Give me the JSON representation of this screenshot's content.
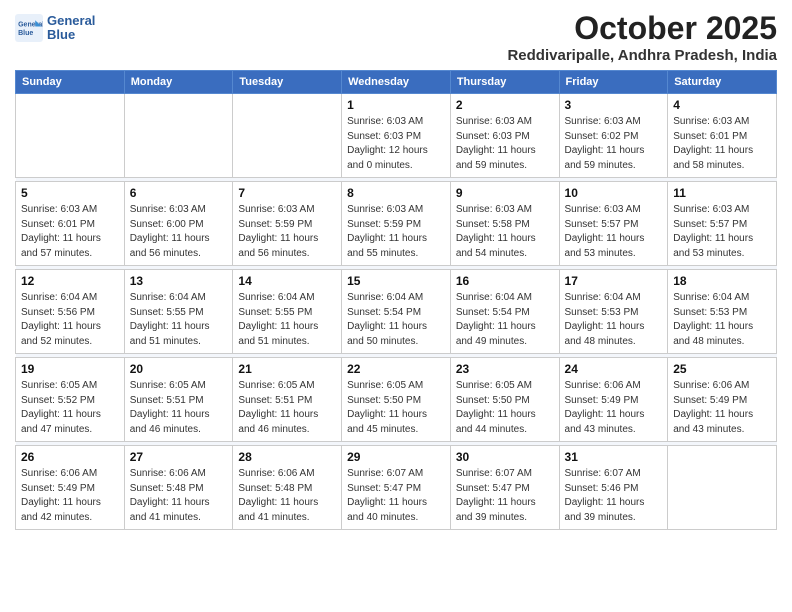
{
  "logo": {
    "line1": "General",
    "line2": "Blue"
  },
  "title": "October 2025",
  "subtitle": "Reddivaripalle, Andhra Pradesh, India",
  "weekdays": [
    "Sunday",
    "Monday",
    "Tuesday",
    "Wednesday",
    "Thursday",
    "Friday",
    "Saturday"
  ],
  "weeks": [
    [
      {
        "day": "",
        "info": ""
      },
      {
        "day": "",
        "info": ""
      },
      {
        "day": "",
        "info": ""
      },
      {
        "day": "1",
        "info": "Sunrise: 6:03 AM\nSunset: 6:03 PM\nDaylight: 12 hours\nand 0 minutes."
      },
      {
        "day": "2",
        "info": "Sunrise: 6:03 AM\nSunset: 6:03 PM\nDaylight: 11 hours\nand 59 minutes."
      },
      {
        "day": "3",
        "info": "Sunrise: 6:03 AM\nSunset: 6:02 PM\nDaylight: 11 hours\nand 59 minutes."
      },
      {
        "day": "4",
        "info": "Sunrise: 6:03 AM\nSunset: 6:01 PM\nDaylight: 11 hours\nand 58 minutes."
      }
    ],
    [
      {
        "day": "5",
        "info": "Sunrise: 6:03 AM\nSunset: 6:01 PM\nDaylight: 11 hours\nand 57 minutes."
      },
      {
        "day": "6",
        "info": "Sunrise: 6:03 AM\nSunset: 6:00 PM\nDaylight: 11 hours\nand 56 minutes."
      },
      {
        "day": "7",
        "info": "Sunrise: 6:03 AM\nSunset: 5:59 PM\nDaylight: 11 hours\nand 56 minutes."
      },
      {
        "day": "8",
        "info": "Sunrise: 6:03 AM\nSunset: 5:59 PM\nDaylight: 11 hours\nand 55 minutes."
      },
      {
        "day": "9",
        "info": "Sunrise: 6:03 AM\nSunset: 5:58 PM\nDaylight: 11 hours\nand 54 minutes."
      },
      {
        "day": "10",
        "info": "Sunrise: 6:03 AM\nSunset: 5:57 PM\nDaylight: 11 hours\nand 53 minutes."
      },
      {
        "day": "11",
        "info": "Sunrise: 6:03 AM\nSunset: 5:57 PM\nDaylight: 11 hours\nand 53 minutes."
      }
    ],
    [
      {
        "day": "12",
        "info": "Sunrise: 6:04 AM\nSunset: 5:56 PM\nDaylight: 11 hours\nand 52 minutes."
      },
      {
        "day": "13",
        "info": "Sunrise: 6:04 AM\nSunset: 5:55 PM\nDaylight: 11 hours\nand 51 minutes."
      },
      {
        "day": "14",
        "info": "Sunrise: 6:04 AM\nSunset: 5:55 PM\nDaylight: 11 hours\nand 51 minutes."
      },
      {
        "day": "15",
        "info": "Sunrise: 6:04 AM\nSunset: 5:54 PM\nDaylight: 11 hours\nand 50 minutes."
      },
      {
        "day": "16",
        "info": "Sunrise: 6:04 AM\nSunset: 5:54 PM\nDaylight: 11 hours\nand 49 minutes."
      },
      {
        "day": "17",
        "info": "Sunrise: 6:04 AM\nSunset: 5:53 PM\nDaylight: 11 hours\nand 48 minutes."
      },
      {
        "day": "18",
        "info": "Sunrise: 6:04 AM\nSunset: 5:53 PM\nDaylight: 11 hours\nand 48 minutes."
      }
    ],
    [
      {
        "day": "19",
        "info": "Sunrise: 6:05 AM\nSunset: 5:52 PM\nDaylight: 11 hours\nand 47 minutes."
      },
      {
        "day": "20",
        "info": "Sunrise: 6:05 AM\nSunset: 5:51 PM\nDaylight: 11 hours\nand 46 minutes."
      },
      {
        "day": "21",
        "info": "Sunrise: 6:05 AM\nSunset: 5:51 PM\nDaylight: 11 hours\nand 46 minutes."
      },
      {
        "day": "22",
        "info": "Sunrise: 6:05 AM\nSunset: 5:50 PM\nDaylight: 11 hours\nand 45 minutes."
      },
      {
        "day": "23",
        "info": "Sunrise: 6:05 AM\nSunset: 5:50 PM\nDaylight: 11 hours\nand 44 minutes."
      },
      {
        "day": "24",
        "info": "Sunrise: 6:06 AM\nSunset: 5:49 PM\nDaylight: 11 hours\nand 43 minutes."
      },
      {
        "day": "25",
        "info": "Sunrise: 6:06 AM\nSunset: 5:49 PM\nDaylight: 11 hours\nand 43 minutes."
      }
    ],
    [
      {
        "day": "26",
        "info": "Sunrise: 6:06 AM\nSunset: 5:49 PM\nDaylight: 11 hours\nand 42 minutes."
      },
      {
        "day": "27",
        "info": "Sunrise: 6:06 AM\nSunset: 5:48 PM\nDaylight: 11 hours\nand 41 minutes."
      },
      {
        "day": "28",
        "info": "Sunrise: 6:06 AM\nSunset: 5:48 PM\nDaylight: 11 hours\nand 41 minutes."
      },
      {
        "day": "29",
        "info": "Sunrise: 6:07 AM\nSunset: 5:47 PM\nDaylight: 11 hours\nand 40 minutes."
      },
      {
        "day": "30",
        "info": "Sunrise: 6:07 AM\nSunset: 5:47 PM\nDaylight: 11 hours\nand 39 minutes."
      },
      {
        "day": "31",
        "info": "Sunrise: 6:07 AM\nSunset: 5:46 PM\nDaylight: 11 hours\nand 39 minutes."
      },
      {
        "day": "",
        "info": ""
      }
    ]
  ]
}
